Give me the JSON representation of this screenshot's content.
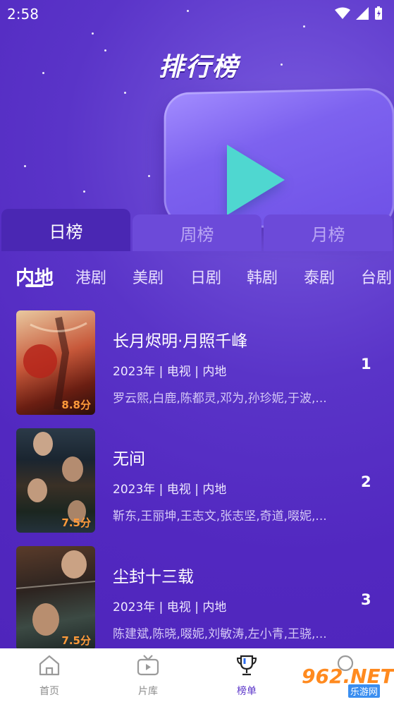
{
  "status_bar": {
    "time": "2:58"
  },
  "hero": {
    "title": "排行榜"
  },
  "tabs": [
    {
      "label": "日榜",
      "active": true
    },
    {
      "label": "周榜",
      "active": false
    },
    {
      "label": "月榜",
      "active": false
    }
  ],
  "categories": [
    {
      "label": "内地",
      "active": true
    },
    {
      "label": "港剧"
    },
    {
      "label": "美剧"
    },
    {
      "label": "日剧"
    },
    {
      "label": "韩剧"
    },
    {
      "label": "泰剧"
    },
    {
      "label": "台剧"
    }
  ],
  "items": [
    {
      "title": "长月烬明·月照千峰",
      "meta": "2023年 | 电视 | 内地",
      "cast": "罗云熙,白鹿,陈都灵,邓为,孙珍妮,于波,...",
      "score": "8.8分",
      "rank": "1"
    },
    {
      "title": "无间",
      "meta": "2023年 | 电视 | 内地",
      "cast": "靳东,王丽坤,王志文,张志坚,奇道,啜妮,...",
      "score": "7.5分",
      "rank": "2"
    },
    {
      "title": "尘封十三载",
      "meta": "2023年 | 电视 | 内地",
      "cast": "陈建斌,陈晓,啜妮,刘敏涛,左小青,王骁,...",
      "score": "7.5分",
      "rank": "3"
    }
  ],
  "bottom_nav": [
    {
      "label": "首页",
      "icon": "home-icon"
    },
    {
      "label": "片库",
      "icon": "tv-icon"
    },
    {
      "label": "榜单",
      "icon": "trophy-icon",
      "active": true
    },
    {
      "label": "",
      "icon": "profile-icon"
    }
  ],
  "watermark": {
    "main": "962.NET",
    "sub": "乐游网"
  },
  "colors": {
    "background": "#5a2fc4",
    "accent": "#5b35c9",
    "score": "#ff9a3a",
    "play": "#4fd7d0"
  }
}
